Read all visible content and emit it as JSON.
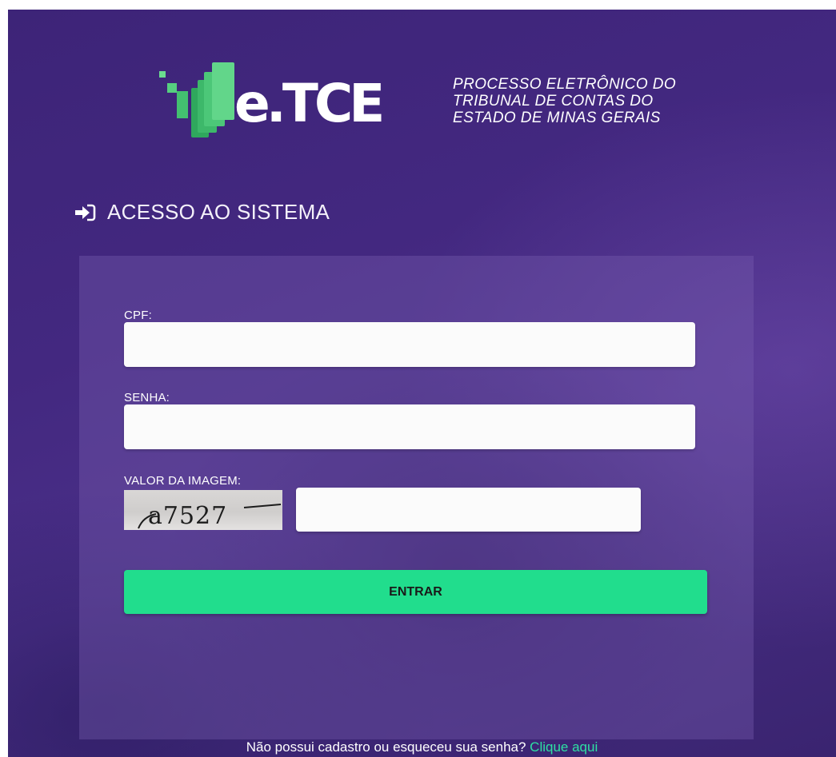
{
  "header": {
    "logo_text": "e.TCE",
    "tagline_lines": [
      "PROCESSO ELETRÔNICO DO",
      "TRIBUNAL DE CONTAS DO",
      "ESTADO DE MINAS GERAIS"
    ]
  },
  "section": {
    "icon": "sign-in-icon",
    "title": "ACESSO AO SISTEMA"
  },
  "form": {
    "cpf_label": "CPF:",
    "cpf_value": "",
    "senha_label": "SENHA:",
    "senha_value": "",
    "captcha_label": "VALOR DA IMAGEM:",
    "captcha_text": "a7527",
    "captcha_value": "",
    "submit_label": "ENTRAR"
  },
  "footer": {
    "question": "Não possui cadastro ou esqueceu sua senha?",
    "link_label": "Clique aqui"
  },
  "colors": {
    "background": "#432880",
    "accent_button": "#21dd8d",
    "link": "#2ee0a3",
    "logo_green_light": "#5fd38a",
    "logo_green_dark": "#2faa5e"
  }
}
